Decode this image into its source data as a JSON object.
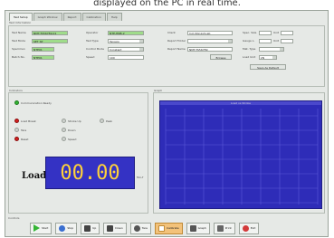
{
  "caption": "displayed on the PC in real time.",
  "window": {
    "tabs": [
      "Test Setup",
      "Graph Window",
      "Report",
      "Calibration",
      "Help"
    ],
    "info_title": "Test Information",
    "fields": [
      {
        "label": "Test Name",
        "value": "NMT-TS56789-01",
        "style": "green"
      },
      {
        "label": "Test Mode",
        "value": "SET SP",
        "style": "green"
      },
      {
        "label": "Specimen",
        "value": "NTE01",
        "style": "white"
      },
      {
        "label": "Batch No.",
        "value": "NTE01",
        "style": "white"
      },
      {
        "label": "Operator",
        "value": "NTE-HNB-2",
        "style": "white"
      },
      {
        "label": "Spec. Size",
        "value": "",
        "style": "white"
      },
      {
        "label": "Unit",
        "value": "",
        "style": "white"
      },
      {
        "label": "Unit",
        "value": "",
        "style": "white"
      },
      {
        "label": "Test Type",
        "value": "Tension",
        "style": "select"
      },
      {
        "label": "Load Unit",
        "value": "kN",
        "style": "select"
      },
      {
        "label": "Control Mode",
        "value": "Constant",
        "style": "select"
      },
      {
        "label": "Speed",
        "value": "100",
        "style": "white"
      },
      {
        "label": "Client",
        "value": "Incl-Nongshi-ab",
        "style": "white"
      },
      {
        "label": "Report Folder",
        "value": "",
        "style": "white"
      },
      {
        "label": "Report Name",
        "value": "NMT-TS56789",
        "style": "white"
      },
      {
        "label": "Mat. Type",
        "value": "",
        "style": "white"
      },
      {
        "label": "Gauge L.",
        "value": "",
        "style": "white"
      }
    ],
    "buttons": {
      "browse": "Browse",
      "save_as": "Save As Default"
    },
    "left_title": "Indicators",
    "status": "Communication Ready",
    "indicators": [
      {
        "label": "Load Break",
        "color": "red"
      },
      {
        "label": "Stroke Up",
        "color": "gray"
      },
      {
        "label": "Peak",
        "color": "gray"
      },
      {
        "label": "Tare",
        "color": "gray"
      },
      {
        "label": "Down",
        "color": "gray"
      },
      {
        "label": "Reset",
        "color": "red"
      },
      {
        "label": "Speed",
        "color": "gray"
      }
    ],
    "load_label": "Load",
    "load_value": "00.00",
    "load_unit": "Ton-f",
    "graph_title": "Graph",
    "plot_caption": "Load vs Stroke",
    "controls_title": "Controls",
    "toolbar": [
      {
        "label": "Start",
        "icon": "play-icon",
        "color": "#35b535"
      },
      {
        "label": "Stop",
        "icon": "stop-icon",
        "color": "#3a6fd0"
      },
      {
        "label": "Up",
        "icon": "arrow-up-icon",
        "color": "#444444"
      },
      {
        "label": "Down",
        "icon": "arrow-down-icon",
        "color": "#444444"
      },
      {
        "label": "Tare",
        "icon": "tare-icon",
        "color": "#444444"
      },
      {
        "label": "Calibrate",
        "icon": "calibrate-icon",
        "color": "#ffffff"
      },
      {
        "label": "Graph",
        "icon": "graph-icon",
        "color": "#444444"
      },
      {
        "label": "Print",
        "icon": "print-icon",
        "color": "#444444"
      },
      {
        "label": "Exit",
        "icon": "exit-icon",
        "color": "#d33a3a"
      }
    ]
  }
}
